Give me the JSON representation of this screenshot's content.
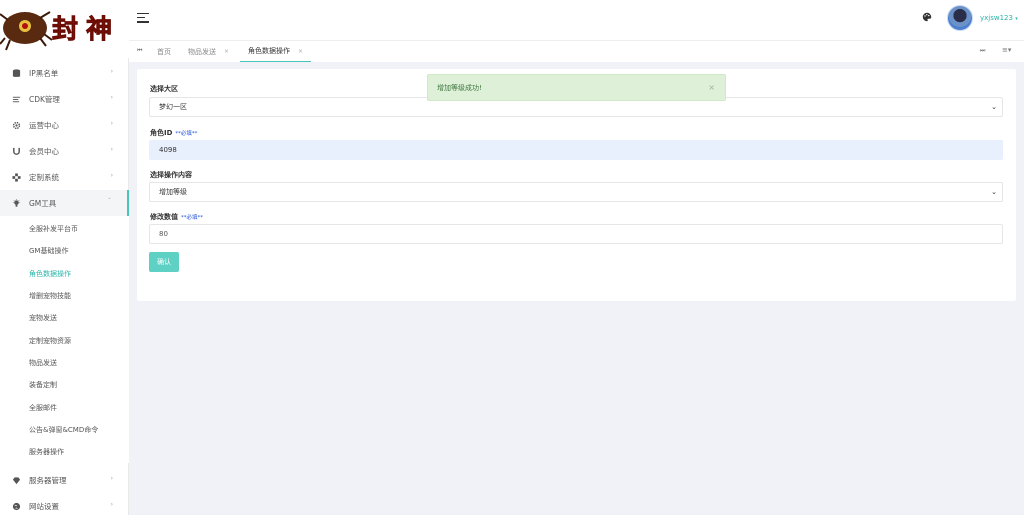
{
  "sidebar": {
    "menu": [
      {
        "label": "IP黑名单",
        "icon": "database-icon"
      },
      {
        "label": "CDK管理",
        "icon": "list-icon"
      },
      {
        "label": "运营中心",
        "icon": "gear-icon"
      },
      {
        "label": "会员中心",
        "icon": "magnet-icon"
      },
      {
        "label": "定制系统",
        "icon": "puzzle-icon"
      },
      {
        "label": "GM工具",
        "icon": "lightbulb-icon"
      }
    ],
    "gm_submenu": [
      "全服补发平台币",
      "GM基础操作",
      "角色数据操作",
      "增删宠物技能",
      "宠物发送",
      "定制宠物资源",
      "物品发送",
      "装备定制",
      "全服邮件",
      "公告&弹窗&CMD命令",
      "服务器操作"
    ],
    "bottom_menu": [
      {
        "label": "服务器管理",
        "icon": "diamond-icon"
      },
      {
        "label": "网站设置",
        "icon": "globe-icon"
      }
    ]
  },
  "header": {
    "username": "yxjsw123"
  },
  "tabs": [
    {
      "label": "首页"
    },
    {
      "label": "物品发送",
      "close": "×"
    },
    {
      "label": "角色数据操作",
      "close": "×"
    }
  ],
  "form": {
    "region_label": "选择大区",
    "region_value": "梦幻一区",
    "role_label": "角色ID",
    "role_required": "**必填**",
    "role_value": "4098",
    "op_label": "选择操作内容",
    "op_value": "增加等级",
    "amount_label": "修改数值",
    "amount_required": "**必填**",
    "amount_value": "80",
    "submit_label": "确认"
  },
  "toast": {
    "message": "增加等级成功!",
    "close": "×"
  },
  "colors": {
    "accent": "#47c5b8",
    "button": "#5fd0c4",
    "toast_bg": "#dff0d8",
    "toast_text": "#3c763d"
  }
}
